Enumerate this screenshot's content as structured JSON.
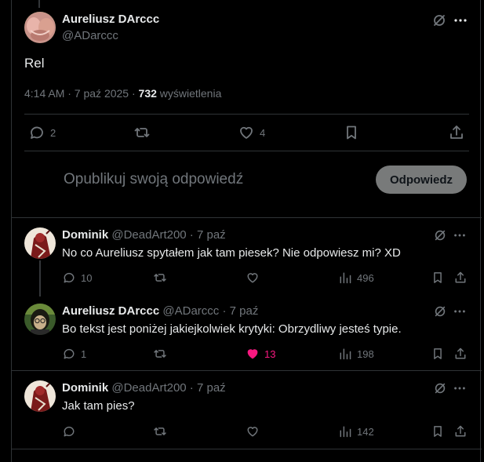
{
  "main_post": {
    "author_name": "Aureliusz DArccc",
    "author_handle": "@ADarccc",
    "text": "Rel",
    "time": "4:14 AM · 7 paź 2025 ·",
    "views_count": "732",
    "views_label": "wyświetlenia",
    "replies": "2",
    "reposts": "",
    "likes": "4"
  },
  "composer": {
    "placeholder": "Opublikuj swoją odpowiedź",
    "reply_button": "Odpowiedz"
  },
  "replies": [
    {
      "author_name": "Dominik",
      "author_handle": "@DeadArt200 · 7 paź",
      "text": "No co Aureliusz spytałem jak tam piesek? Nie odpowiesz mi? XD",
      "replies": "10",
      "likes": "",
      "liked": false,
      "views": "496"
    },
    {
      "author_name": "Aureliusz DArccc",
      "author_handle": "@ADarccc · 7 paź",
      "text": "Bo tekst jest poniżej jakiejkolwiek krytyki: Obrzydliwy jesteś typie.",
      "replies": "1",
      "likes": "13",
      "liked": true,
      "views": "198"
    },
    {
      "author_name": "Dominik",
      "author_handle": "@DeadArt200 · 7 paź",
      "text": "Jak tam pies?",
      "replies": "",
      "likes": "",
      "liked": false,
      "views": "142"
    }
  ],
  "colors": {
    "background": "#000000",
    "text": "#e7e9ea",
    "muted": "#71767b",
    "like_active": "#f91880",
    "border": "#2f3336"
  },
  "icons": [
    "grok-icon",
    "more-icon",
    "reply-icon",
    "repost-icon",
    "like-icon",
    "bookmark-icon",
    "share-icon",
    "views-icon"
  ]
}
